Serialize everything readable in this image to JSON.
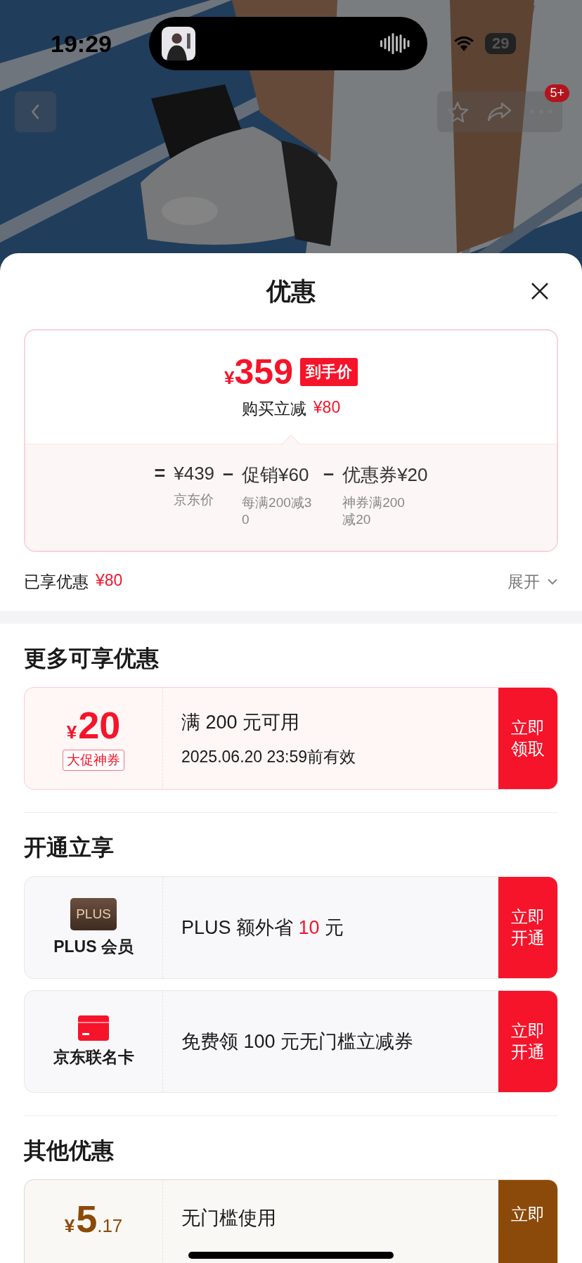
{
  "status_bar": {
    "time": "19:29",
    "battery": "29"
  },
  "nav": {
    "badge": "5+"
  },
  "sheet": {
    "title": "优惠",
    "price": {
      "currency": "¥",
      "amount": "359",
      "tag": "到手价",
      "discount_label": "购买立减",
      "discount": "¥80"
    },
    "breakdown": [
      {
        "operator": "=",
        "amount": "¥439",
        "note": "京东价"
      },
      {
        "operator": "–",
        "amount": "促销¥60",
        "note": "每满200减30"
      },
      {
        "operator": "–",
        "amount": "优惠券¥20",
        "note": "神券满200减20"
      }
    ],
    "enjoyed": {
      "label": "已享优惠",
      "value": "¥80"
    },
    "expand": {
      "label": "展开",
      "expanded": false
    },
    "sections": [
      {
        "title": "更多可享优惠",
        "cards": [
          {
            "kind": "coupon",
            "color": "#f5142a",
            "currency": "¥",
            "amount": "20",
            "tag": "大促神券",
            "lines": [
              "满 200 元可用",
              "2025.06.20 23:59前有效"
            ],
            "button": "立即领取"
          }
        ]
      },
      {
        "title": "开通立享",
        "cards": [
          {
            "kind": "plus",
            "icon_text": "PLUS",
            "label": "PLUS 会员",
            "desc": [
              {
                "text": "PLUS 额外省 ",
                "highlight": false
              },
              {
                "text": "10",
                "highlight": true
              },
              {
                "text": " 元",
                "highlight": false
              }
            ],
            "button": "立即开通"
          },
          {
            "kind": "bankcard",
            "label": "京东联名卡",
            "desc": [
              {
                "text": "免费领 100 元无门槛立减券",
                "highlight": false
              }
            ],
            "button": "立即开通"
          }
        ]
      },
      {
        "title": "其他优惠",
        "cards": [
          {
            "kind": "coupon",
            "color": "#8c4a0a",
            "currency": "¥",
            "amount": "5",
            "decimal": ".17",
            "lines": [
              "无门槛使用"
            ],
            "button": "立即"
          }
        ]
      }
    ]
  }
}
